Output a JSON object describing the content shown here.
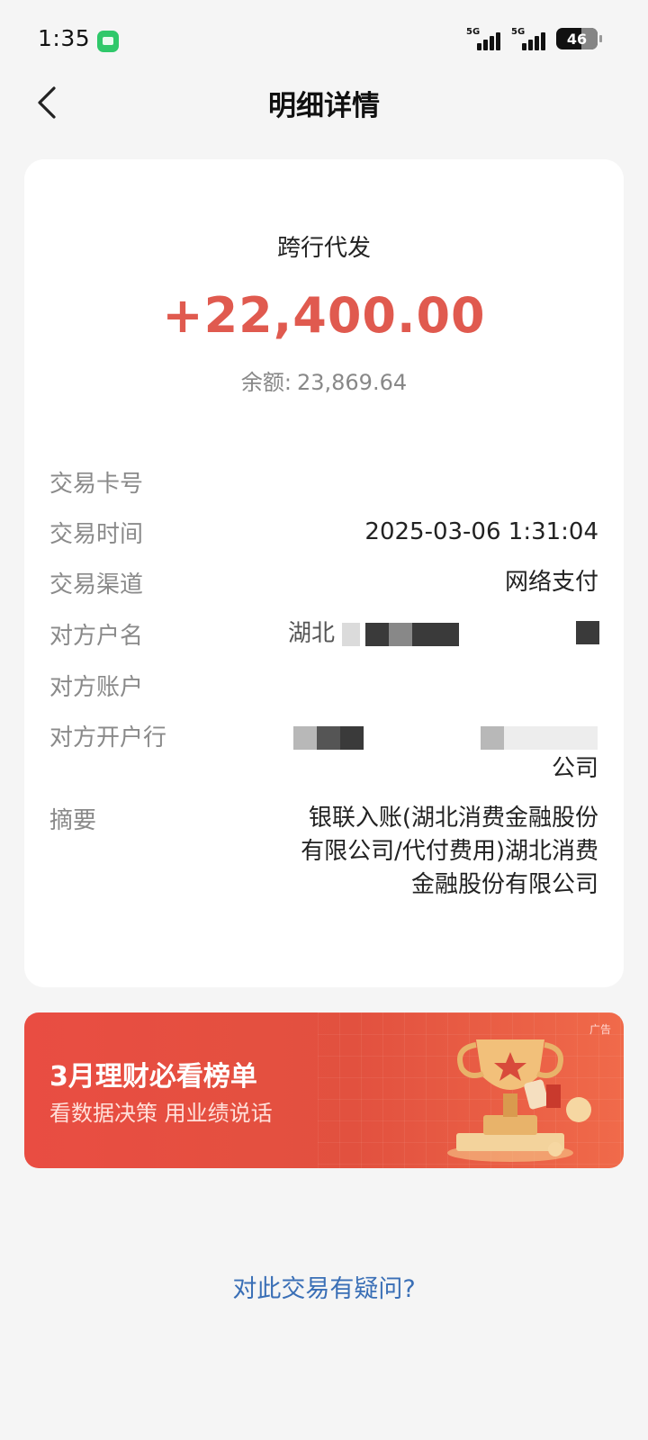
{
  "status_bar": {
    "time": "1:35",
    "network_1": "5G",
    "network_2": "5G",
    "battery_level": "46"
  },
  "header": {
    "title": "明细详情"
  },
  "transaction": {
    "type": "跨行代发",
    "amount": "+22,400.00",
    "balance_label": "余额:",
    "balance_value": "23,869.64",
    "fields": {
      "card_number_label": "交易卡号",
      "time_label": "交易时间",
      "time_value": "2025-03-06 1:31:04",
      "channel_label": "交易渠道",
      "channel_value": "网络支付",
      "payer_name_label": "对方户名",
      "payer_name_partial": "湖北",
      "payer_account_label": "对方账户",
      "payer_bank_label": "对方开户行",
      "payer_bank_tail": "公司",
      "memo_label": "摘要",
      "memo_line1": "银联入账(湖北消费金融股份",
      "memo_line2": "有限公司/代付费用)湖北消费",
      "memo_line3": "金融股份有限公司"
    }
  },
  "banner": {
    "ad_tag": "广告",
    "title": "3月理财必看榜单",
    "subtitle": "看数据决策 用业绩说话"
  },
  "footer_link": "对此交易有疑问?",
  "colors": {
    "amount": "#e05a4f",
    "link": "#3a6fb6",
    "banner": "#e94d42"
  }
}
